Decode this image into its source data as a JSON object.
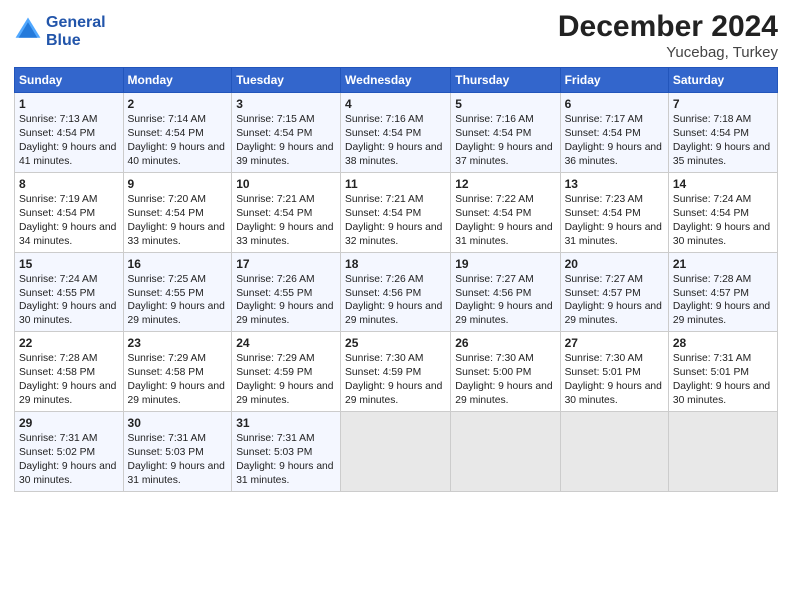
{
  "logo": {
    "line1": "General",
    "line2": "Blue"
  },
  "title": "December 2024",
  "subtitle": "Yucebag, Turkey",
  "days_of_week": [
    "Sunday",
    "Monday",
    "Tuesday",
    "Wednesday",
    "Thursday",
    "Friday",
    "Saturday"
  ],
  "weeks": [
    [
      {
        "day": 1,
        "sunrise": "7:13 AM",
        "sunset": "4:54 PM",
        "daylight": "9 hours and 41 minutes."
      },
      {
        "day": 2,
        "sunrise": "7:14 AM",
        "sunset": "4:54 PM",
        "daylight": "9 hours and 40 minutes."
      },
      {
        "day": 3,
        "sunrise": "7:15 AM",
        "sunset": "4:54 PM",
        "daylight": "9 hours and 39 minutes."
      },
      {
        "day": 4,
        "sunrise": "7:16 AM",
        "sunset": "4:54 PM",
        "daylight": "9 hours and 38 minutes."
      },
      {
        "day": 5,
        "sunrise": "7:16 AM",
        "sunset": "4:54 PM",
        "daylight": "9 hours and 37 minutes."
      },
      {
        "day": 6,
        "sunrise": "7:17 AM",
        "sunset": "4:54 PM",
        "daylight": "9 hours and 36 minutes."
      },
      {
        "day": 7,
        "sunrise": "7:18 AM",
        "sunset": "4:54 PM",
        "daylight": "9 hours and 35 minutes."
      }
    ],
    [
      {
        "day": 8,
        "sunrise": "7:19 AM",
        "sunset": "4:54 PM",
        "daylight": "9 hours and 34 minutes."
      },
      {
        "day": 9,
        "sunrise": "7:20 AM",
        "sunset": "4:54 PM",
        "daylight": "9 hours and 33 minutes."
      },
      {
        "day": 10,
        "sunrise": "7:21 AM",
        "sunset": "4:54 PM",
        "daylight": "9 hours and 33 minutes."
      },
      {
        "day": 11,
        "sunrise": "7:21 AM",
        "sunset": "4:54 PM",
        "daylight": "9 hours and 32 minutes."
      },
      {
        "day": 12,
        "sunrise": "7:22 AM",
        "sunset": "4:54 PM",
        "daylight": "9 hours and 31 minutes."
      },
      {
        "day": 13,
        "sunrise": "7:23 AM",
        "sunset": "4:54 PM",
        "daylight": "9 hours and 31 minutes."
      },
      {
        "day": 14,
        "sunrise": "7:24 AM",
        "sunset": "4:54 PM",
        "daylight": "9 hours and 30 minutes."
      }
    ],
    [
      {
        "day": 15,
        "sunrise": "7:24 AM",
        "sunset": "4:55 PM",
        "daylight": "9 hours and 30 minutes."
      },
      {
        "day": 16,
        "sunrise": "7:25 AM",
        "sunset": "4:55 PM",
        "daylight": "9 hours and 29 minutes."
      },
      {
        "day": 17,
        "sunrise": "7:26 AM",
        "sunset": "4:55 PM",
        "daylight": "9 hours and 29 minutes."
      },
      {
        "day": 18,
        "sunrise": "7:26 AM",
        "sunset": "4:56 PM",
        "daylight": "9 hours and 29 minutes."
      },
      {
        "day": 19,
        "sunrise": "7:27 AM",
        "sunset": "4:56 PM",
        "daylight": "9 hours and 29 minutes."
      },
      {
        "day": 20,
        "sunrise": "7:27 AM",
        "sunset": "4:57 PM",
        "daylight": "9 hours and 29 minutes."
      },
      {
        "day": 21,
        "sunrise": "7:28 AM",
        "sunset": "4:57 PM",
        "daylight": "9 hours and 29 minutes."
      }
    ],
    [
      {
        "day": 22,
        "sunrise": "7:28 AM",
        "sunset": "4:58 PM",
        "daylight": "9 hours and 29 minutes."
      },
      {
        "day": 23,
        "sunrise": "7:29 AM",
        "sunset": "4:58 PM",
        "daylight": "9 hours and 29 minutes."
      },
      {
        "day": 24,
        "sunrise": "7:29 AM",
        "sunset": "4:59 PM",
        "daylight": "9 hours and 29 minutes."
      },
      {
        "day": 25,
        "sunrise": "7:30 AM",
        "sunset": "4:59 PM",
        "daylight": "9 hours and 29 minutes."
      },
      {
        "day": 26,
        "sunrise": "7:30 AM",
        "sunset": "5:00 PM",
        "daylight": "9 hours and 29 minutes."
      },
      {
        "day": 27,
        "sunrise": "7:30 AM",
        "sunset": "5:01 PM",
        "daylight": "9 hours and 30 minutes."
      },
      {
        "day": 28,
        "sunrise": "7:31 AM",
        "sunset": "5:01 PM",
        "daylight": "9 hours and 30 minutes."
      }
    ],
    [
      {
        "day": 29,
        "sunrise": "7:31 AM",
        "sunset": "5:02 PM",
        "daylight": "9 hours and 30 minutes."
      },
      {
        "day": 30,
        "sunrise": "7:31 AM",
        "sunset": "5:03 PM",
        "daylight": "9 hours and 31 minutes."
      },
      {
        "day": 31,
        "sunrise": "7:31 AM",
        "sunset": "5:03 PM",
        "daylight": "9 hours and 31 minutes."
      },
      null,
      null,
      null,
      null
    ]
  ],
  "labels": {
    "sunrise": "Sunrise:",
    "sunset": "Sunset:",
    "daylight": "Daylight:"
  }
}
